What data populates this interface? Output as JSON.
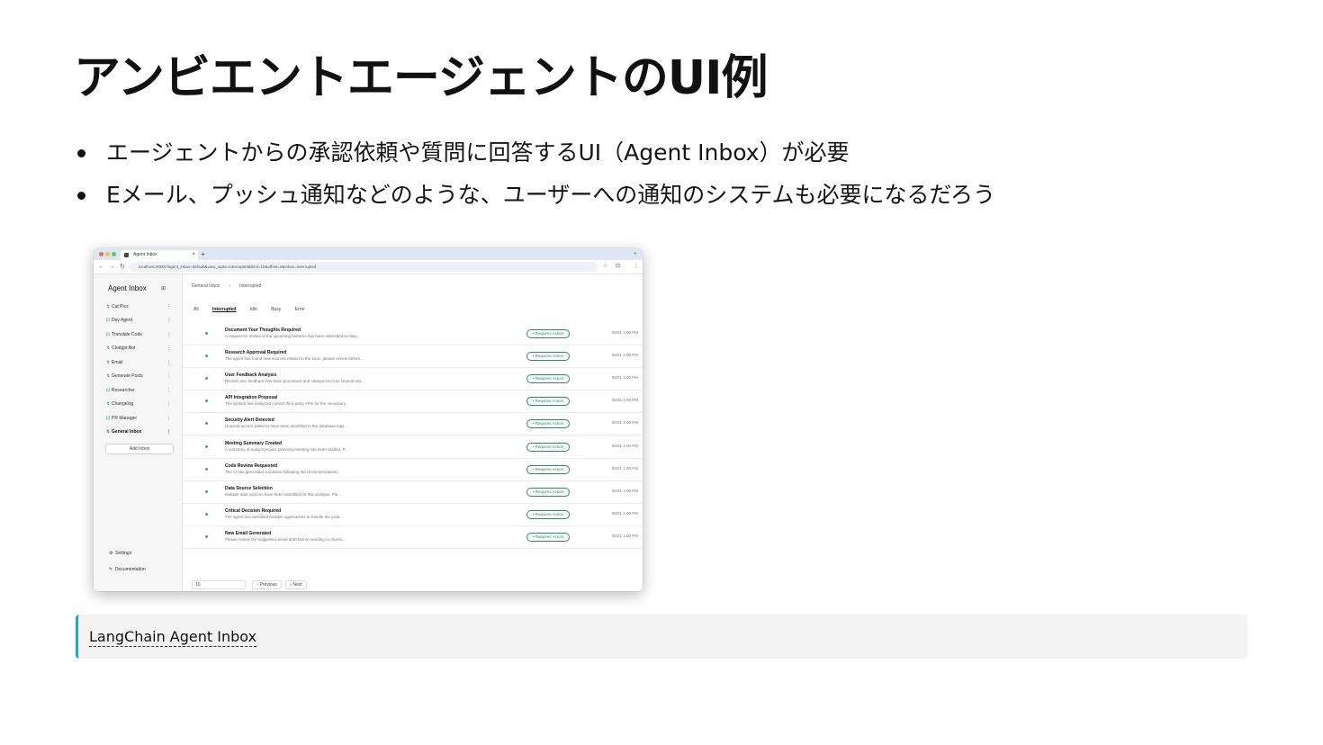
{
  "slide": {
    "title": "アンビエントエージェントのUI例",
    "bullets": [
      "エージェントからの承認依頼や質問に回答するUI（Agent Inbox）が必要",
      "Eメール、プッシュ通知などのような、ユーザーへの通知のシステムも必要になるだろう"
    ]
  },
  "screenshot": {
    "browser": {
      "tab_title": "Agent Inbox",
      "tab_close": "×",
      "new_tab": "+",
      "menu": "⌄",
      "nav": [
        "←",
        "→",
        "↻"
      ],
      "url": "localhost:3000/?agent_inbox=default&view_state=interrupted&limit=10&offset=0&inbox=interrupted",
      "addr_icons": [
        "☆",
        "⊡",
        "⋮"
      ]
    },
    "sidebar": {
      "brand": "Agent Inbox",
      "brand_icon": "⊞",
      "items": [
        {
          "label": "Cat Pics",
          "icon": "↯"
        },
        {
          "label": "Dev Agent",
          "icon": "⊡"
        },
        {
          "label": "Translate Code",
          "icon": "⊡"
        },
        {
          "label": "Chatgpt Bot",
          "icon": "↯"
        },
        {
          "label": "Email",
          "icon": "↯"
        },
        {
          "label": "Generate Posts",
          "icon": "↯"
        },
        {
          "label": "Researcher",
          "icon": "⊡"
        },
        {
          "label": "Changelog",
          "icon": "↯"
        },
        {
          "label": "PR Manager",
          "icon": "⊡"
        },
        {
          "label": "General Inbox",
          "icon": "↯"
        }
      ],
      "kebab": "⋮",
      "add_inbox": "Add Inbox",
      "settings": "Settings",
      "documentation": "Documentation"
    },
    "main": {
      "breadcrumb": [
        "General Inbox",
        "Interrupted"
      ],
      "filters": [
        "All",
        "Interrupted",
        "Idle",
        "Busy",
        "Error"
      ],
      "active_filter": "Interrupted",
      "badge_label": "• Requires Action",
      "rows": [
        {
          "title": "Document Your Thoughts Required",
          "desc": "A request for review of the upcoming features has been submitted to help...",
          "time": "05/01 1:00 PM"
        },
        {
          "title": "Research Approval Required",
          "desc": "The agent has found new sources related to the topic, please review before...",
          "time": "05/01 1:00 PM"
        },
        {
          "title": "User Feedback Analysis",
          "desc": "Recent user feedback has been processed and categorized into several key...",
          "time": "05/01 1:00 PM"
        },
        {
          "title": "API Integration Proposal",
          "desc": "The system has analyzed current third-party APIs for the necessary...",
          "time": "05/01 1:00 PM"
        },
        {
          "title": "Security Alert Detected",
          "desc": "Unusual access patterns have been identified in the database logs...",
          "time": "05/01 1:00 PM"
        },
        {
          "title": "Meeting Summary Created",
          "desc": "A summary of today's project planning meeting has been drafted. P...",
          "time": "05/01 1:00 PM"
        },
        {
          "title": "Code Review Requested",
          "desc": "The AI has generated a solution following the recommendation...",
          "time": "05/01 1:00 PM"
        },
        {
          "title": "Data Source Selection",
          "desc": "Multiple data sources have been identified for this analysis. Ple...",
          "time": "05/01 1:00 PM"
        },
        {
          "title": "Critical Decision Required",
          "desc": "The agent has identified multiple approaches to handle the prob...",
          "time": "05/01 1:00 PM"
        },
        {
          "title": "New Email Generated",
          "desc": "Please review the suggested email draft before sending to clients...",
          "time": "05/01 1:00 PM"
        }
      ],
      "pager": {
        "page_size": "10",
        "prev": "‹ Previous",
        "next": "› Next"
      }
    }
  },
  "callout": {
    "link_text": "LangChain Agent Inbox"
  },
  "colors": {
    "accent_border": "#26a6b8",
    "callout_bg": "#f3f3f3",
    "badge_green": "#2e8b57"
  }
}
